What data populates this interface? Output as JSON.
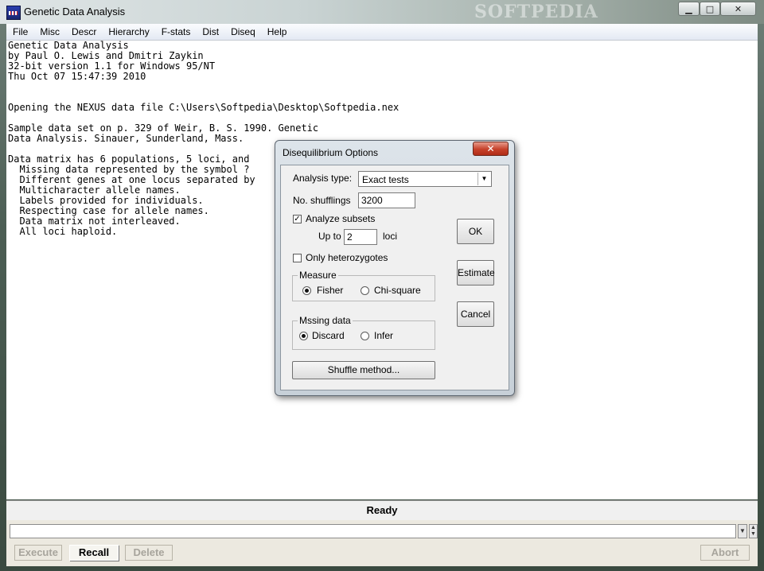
{
  "window": {
    "title": "Genetic Data Analysis",
    "watermark": "SOFTPEDIA",
    "min_glyph": "▁",
    "max_glyph": "□",
    "close_glyph": "✕"
  },
  "menu": [
    "File",
    "Misc",
    "Descr",
    "Hierarchy",
    "F-stats",
    "Dist",
    "Diseq",
    "Help"
  ],
  "output_text": "Genetic Data Analysis\nby Paul O. Lewis and Dmitri Zaykin\n32-bit version 1.1 for Windows 95/NT\nThu Oct 07 15:47:39 2010\n\n\nOpening the NEXUS data file C:\\Users\\Softpedia\\Desktop\\Softpedia.nex\n\nSample data set on p. 329 of Weir, B. S. 1990. Genetic\nData Analysis. Sinauer, Sunderland, Mass.\n\nData matrix has 6 populations, 5 loci, and\n  Missing data represented by the symbol ?\n  Different genes at one locus separated by\n  Multicharacter allele names.\n  Labels provided for individuals.\n  Respecting case for allele names.\n  Data matrix not interleaved.\n  All loci haploid.",
  "status": "Ready",
  "command": {
    "input_value": "",
    "buttons": {
      "execute": "Execute",
      "recall": "Recall",
      "delete": "Delete",
      "abort": "Abort"
    }
  },
  "dialog": {
    "title": "Disequilibrium Options",
    "close_glyph": "✕",
    "analysis_type_label": "Analysis type:",
    "analysis_type_value": "Exact tests",
    "shufflings_label": "No. shufflings",
    "shufflings_value": "3200",
    "analyze_subsets_label": "Analyze subsets",
    "analyze_subsets_checked": true,
    "upto_label": "Up to",
    "upto_value": "2",
    "loci_label": "loci",
    "only_het_label": "Only heterozygotes",
    "only_het_checked": false,
    "measure_group": "Measure",
    "measure_options": [
      "Fisher",
      "Chi-square"
    ],
    "measure_selected": "Fisher",
    "missing_group": "Mssing data",
    "missing_options": [
      "Discard",
      "Infer"
    ],
    "missing_selected": "Discard",
    "shuffle_button": "Shuffle method...",
    "ok_button": "OK",
    "estimate_button": "Estimate",
    "cancel_button": "Cancel",
    "check_glyph": "✓"
  }
}
